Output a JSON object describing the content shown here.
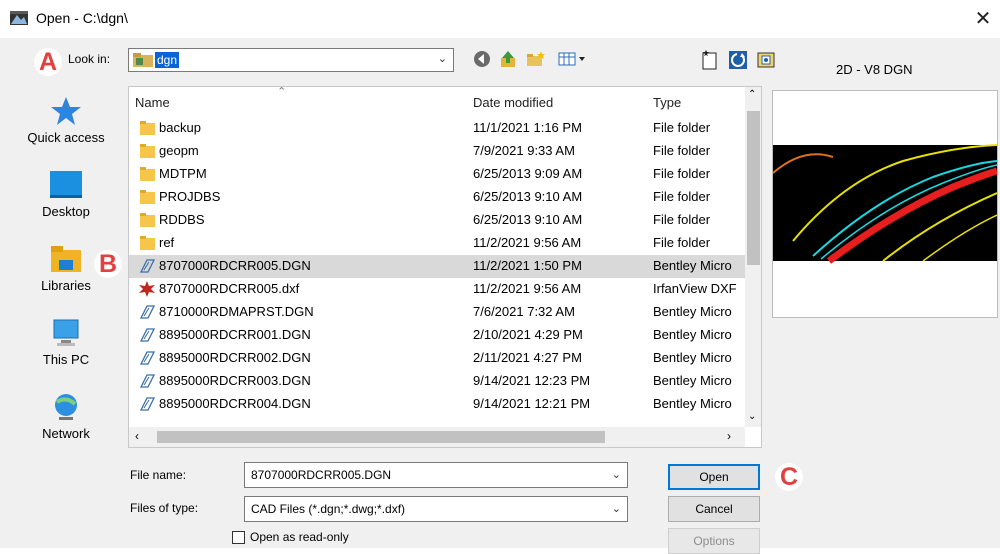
{
  "window": {
    "title": "Open - C:\\dgn\\",
    "close_glyph": "✕"
  },
  "markers": {
    "a": "A",
    "b": "B",
    "c": "C"
  },
  "look_in": {
    "label": "Look in:",
    "value": "dgn"
  },
  "toolbar": {
    "icons": [
      "back-icon",
      "up-folder-icon",
      "new-folder-icon",
      "view-menu-icon",
      "new-file-icon",
      "refresh-icon",
      "favorites-icon"
    ]
  },
  "sidebar": {
    "items": [
      {
        "label": "Quick access",
        "icon": "star-icon"
      },
      {
        "label": "Desktop",
        "icon": "desktop-icon"
      },
      {
        "label": "Libraries",
        "icon": "libraries-icon"
      },
      {
        "label": "This PC",
        "icon": "computer-icon"
      },
      {
        "label": "Network",
        "icon": "network-icon"
      }
    ]
  },
  "file_list": {
    "columns": {
      "name": "Name",
      "date": "Date modified",
      "type": "Type"
    },
    "rows": [
      {
        "name": "backup",
        "date": "11/1/2021 1:16 PM",
        "type": "File folder",
        "icon": "folder-icon"
      },
      {
        "name": "geopm",
        "date": "7/9/2021 9:33 AM",
        "type": "File folder",
        "icon": "folder-icon"
      },
      {
        "name": "MDTPM",
        "date": "6/25/2013 9:09 AM",
        "type": "File folder",
        "icon": "folder-icon"
      },
      {
        "name": "PROJDBS",
        "date": "6/25/2013 9:10 AM",
        "type": "File folder",
        "icon": "folder-icon"
      },
      {
        "name": "RDDBS",
        "date": "6/25/2013 9:10 AM",
        "type": "File folder",
        "icon": "folder-icon"
      },
      {
        "name": "ref",
        "date": "11/2/2021 9:56 AM",
        "type": "File folder",
        "icon": "folder-icon"
      },
      {
        "name": "8707000RDCRR005.DGN",
        "date": "11/2/2021 1:50 PM",
        "type": "Bentley Micro",
        "icon": "dgn-file-icon",
        "selected": true
      },
      {
        "name": "8707000RDCRR005.dxf",
        "date": "11/2/2021 9:56 AM",
        "type": "IrfanView DXF",
        "icon": "dxf-file-icon"
      },
      {
        "name": "8710000RDMAPRST.DGN",
        "date": "7/6/2021 7:32 AM",
        "type": "Bentley Micro",
        "icon": "dgn-file-icon"
      },
      {
        "name": "8895000RDCRR001.DGN",
        "date": "2/10/2021 4:29 PM",
        "type": "Bentley Micro",
        "icon": "dgn-file-icon"
      },
      {
        "name": "8895000RDCRR002.DGN",
        "date": "2/11/2021 4:27 PM",
        "type": "Bentley Micro",
        "icon": "dgn-file-icon"
      },
      {
        "name": "8895000RDCRR003.DGN",
        "date": "9/14/2021 12:23 PM",
        "type": "Bentley Micro",
        "icon": "dgn-file-icon"
      },
      {
        "name": "8895000RDCRR004.DGN",
        "date": "9/14/2021 12:21 PM",
        "type": "Bentley Micro",
        "icon": "dgn-file-icon"
      }
    ]
  },
  "preview": {
    "label": "2D - V8 DGN"
  },
  "file_name": {
    "label": "File name:",
    "value": "8707000RDCRR005.DGN"
  },
  "file_type": {
    "label": "Files of type:",
    "value": "CAD Files (*.dgn;*.dwg;*.dxf)"
  },
  "read_only": {
    "label": "Open as read-only",
    "checked": false
  },
  "buttons": {
    "open": "Open",
    "cancel": "Cancel",
    "options": "Options"
  },
  "colors": {
    "selection": "#0a64d8",
    "marker": "#e2403e",
    "default_button_border": "#0078d7"
  }
}
